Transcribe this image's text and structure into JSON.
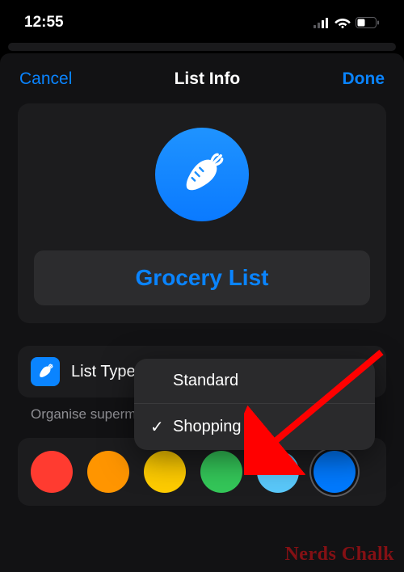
{
  "status": {
    "time": "12:55"
  },
  "nav": {
    "cancel": "Cancel",
    "title": "List Info",
    "done": "Done"
  },
  "list": {
    "name": "Grocery List"
  },
  "listType": {
    "label": "List Type",
    "value": "Shopping",
    "options": [
      "Standard",
      "Shopping"
    ],
    "selected": "Shopping"
  },
  "hint": "Organise supermarket essentials using sections.",
  "menu": {
    "option0": "Standard",
    "option1": "Shopping"
  },
  "watermark": "Nerds Chalk"
}
